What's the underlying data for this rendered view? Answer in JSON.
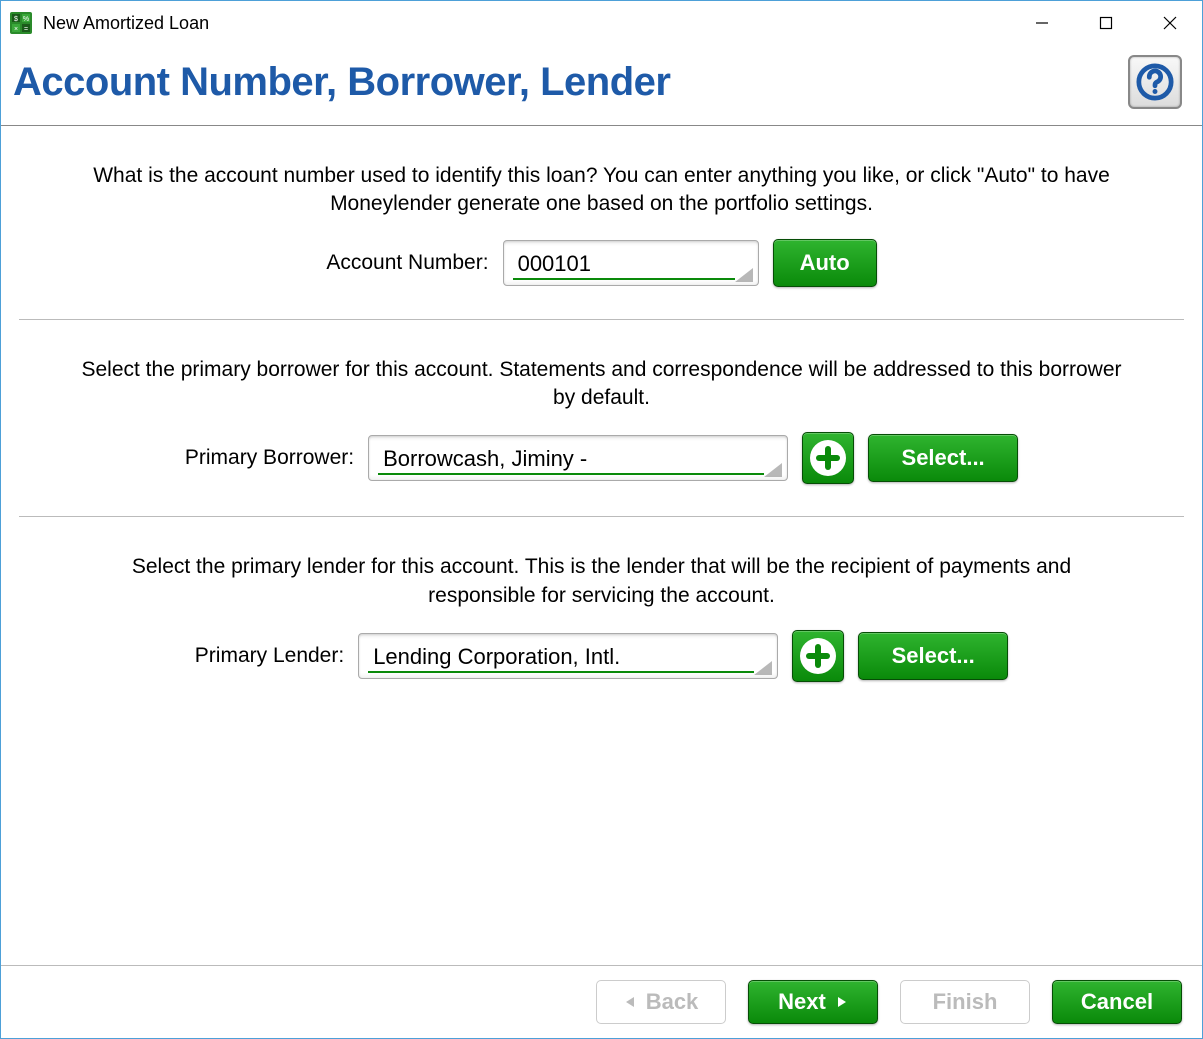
{
  "window": {
    "title": "New Amortized Loan"
  },
  "page": {
    "title": "Account Number, Borrower, Lender"
  },
  "account": {
    "description": "What is the account number used to identify this loan? You can enter anything you like, or click \"Auto\" to have Moneylender generate one based on the portfolio settings.",
    "label": "Account Number:",
    "value": "000101",
    "auto_label": "Auto"
  },
  "borrower": {
    "description": "Select the primary borrower for this account. Statements and correspondence will be addressed to this borrower by default.",
    "label": "Primary Borrower:",
    "value": "Borrowcash, Jiminy -",
    "select_label": "Select..."
  },
  "lender": {
    "description": "Select the primary lender for this account. This is the lender that will be the recipient of payments and responsible for servicing the account.",
    "label": "Primary Lender:",
    "value": "Lending Corporation, Intl.",
    "select_label": "Select..."
  },
  "footer": {
    "back": "Back",
    "next": "Next",
    "finish": "Finish",
    "cancel": "Cancel"
  }
}
